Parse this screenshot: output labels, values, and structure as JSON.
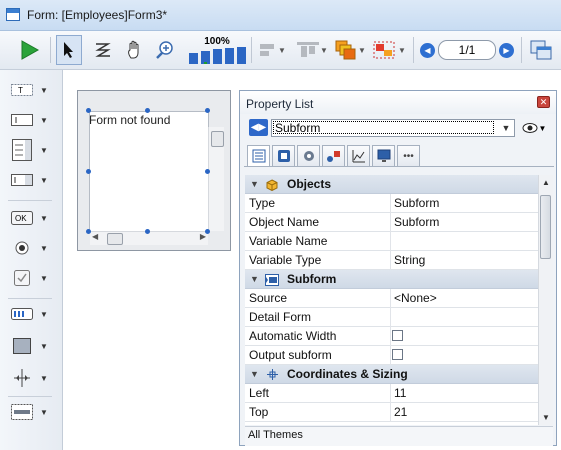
{
  "window": {
    "title": "Form: [Employees]Form3*"
  },
  "toolbar": {
    "zoom_label": "100%",
    "page_indicator": "1/1"
  },
  "form_preview": {
    "message": "Form not found"
  },
  "property_list": {
    "title": "Property List",
    "selected_object": "Subform",
    "themes_label": "All Themes",
    "groups": [
      {
        "label": "Objects",
        "rows": [
          {
            "key": "Type",
            "value": "Subform"
          },
          {
            "key": "Object Name",
            "value": "Subform"
          },
          {
            "key": "Variable Name",
            "value": ""
          },
          {
            "key": "Variable Type",
            "value": "String"
          }
        ]
      },
      {
        "label": "Subform",
        "rows": [
          {
            "key": "Source",
            "value": "<None>"
          },
          {
            "key": "Detail Form",
            "value": ""
          },
          {
            "key": "Automatic Width",
            "value": "",
            "checkbox": false
          },
          {
            "key": "Output subform",
            "value": "",
            "checkbox": false
          }
        ]
      },
      {
        "label": "Coordinates & Sizing",
        "rows": [
          {
            "key": "Left",
            "value": "11"
          },
          {
            "key": "Top",
            "value": "21"
          }
        ]
      }
    ]
  },
  "icons": {
    "toolbar": [
      "play-icon",
      "arrow-pointer-icon",
      "reorder-icon",
      "hand-icon",
      "zoom-icon",
      "bar-chart-zoom-icon",
      "align-icon",
      "distribute-icon",
      "layer-icon",
      "group-icon",
      "prev-page-icon",
      "next-page-icon",
      "windows-icon"
    ],
    "palette": [
      "text-object-icon",
      "input-field-icon",
      "list-box-icon",
      "combo-box-icon",
      "ok-button-icon",
      "radio-button-icon",
      "checkbox-icon",
      "ruler-icon",
      "rectangle-icon",
      "splitter-icon",
      "subform-object-icon"
    ]
  },
  "colors": {
    "accent": "#2b66c4",
    "titlebar": "#dce9f7",
    "group_header": "#d6dfea"
  }
}
